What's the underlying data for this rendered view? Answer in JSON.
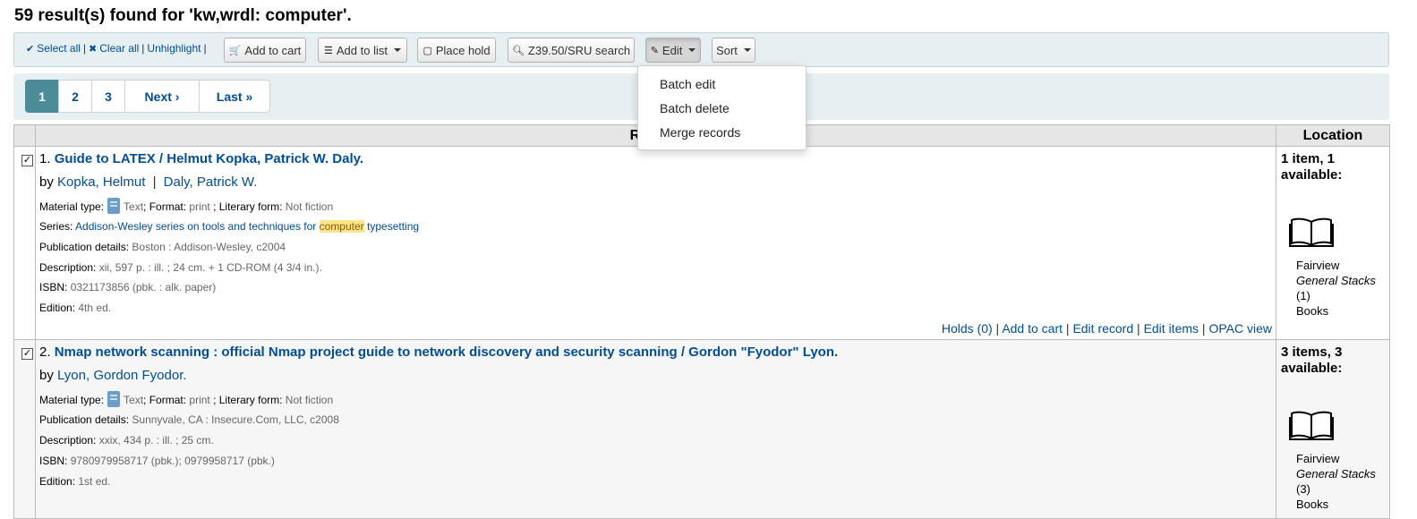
{
  "header": {
    "title": "59 result(s) found for 'kw,wrdl: computer'."
  },
  "toolbar": {
    "select_all": "Select all",
    "clear_all": "Clear all",
    "unhighlight": "Unhighlight",
    "add_to_cart": "Add to cart",
    "add_to_list": "Add to list",
    "place_hold": "Place hold",
    "z3950": "Z39.50/SRU search",
    "edit": "Edit",
    "sort": "Sort"
  },
  "edit_menu": {
    "items": [
      "Batch edit",
      "Batch delete",
      "Merge records"
    ]
  },
  "pagination": {
    "pages": [
      "1",
      "2",
      "3"
    ],
    "next": "Next ›",
    "last": "Last »",
    "current_page": 1
  },
  "table": {
    "col_results": "Results",
    "col_location": "Location"
  },
  "labels": {
    "material_type": "Material type:",
    "format": "; Format:",
    "literary_form": "; Literary form:",
    "series": "Series:",
    "publication": "Publication details:",
    "description": "Description:",
    "isbn": "ISBN:",
    "edition": "Edition:",
    "by": "by"
  },
  "results": [
    {
      "num": "1.",
      "title": "Guide to LATEX / Helmut Kopka, Patrick W. Daly.",
      "authors": [
        "Kopka, Helmut",
        "Daly, Patrick W."
      ],
      "material_type": "Text",
      "format": "print",
      "literary_form": "Not fiction",
      "series_pre": "Addison-Wesley series on tools and techniques for",
      "series_hl": "computer",
      "series_post": "typesetting",
      "publication": "Boston : Addison-Wesley, c2004",
      "description": "xii, 597 p. : ill. ; 24 cm. + 1 CD-ROM (4 3/4 in.).",
      "isbn": "0321173856 (pbk. : alk. paper)",
      "edition": "4th ed.",
      "actions": [
        "Holds (0)",
        "Add to cart",
        "Edit record",
        "Edit items",
        "OPAC view"
      ],
      "availability": "1 item, 1 available:",
      "library": "Fairview",
      "collection": "General Stacks",
      "count": "(1)",
      "item_type": "Books"
    },
    {
      "num": "2.",
      "title": "Nmap network scanning : official Nmap project guide to network discovery and security scanning / Gordon \"Fyodor\" Lyon.",
      "authors": [
        "Lyon, Gordon Fyodor."
      ],
      "material_type": "Text",
      "format": "print",
      "literary_form": "Not fiction",
      "publication": "Sunnyvale, CA : Insecure.Com, LLC, c2008",
      "description": "xxix, 434 p. : ill. ; 25 cm.",
      "isbn": "9780979958717 (pbk.); 0979958717 (pbk.)",
      "edition": "1st ed.",
      "availability": "3 items, 3 available:",
      "library": "Fairview",
      "collection": "General Stacks",
      "count": "(3)",
      "item_type": "Books"
    }
  ],
  "colors": {
    "link": "#004d99",
    "pager_active": "#4c8c99",
    "toolbar_bg": "#e6f0f2",
    "highlight": "#ffe58a"
  }
}
